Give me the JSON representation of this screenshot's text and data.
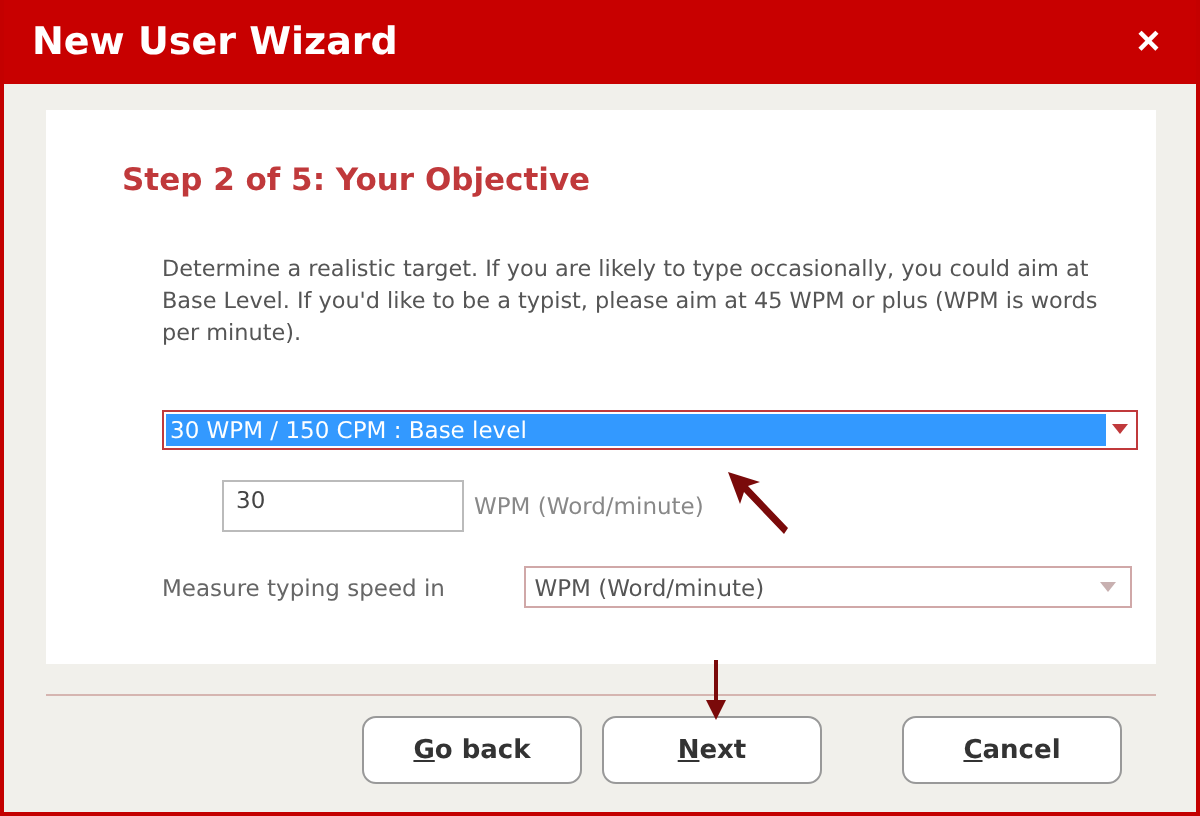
{
  "window": {
    "title": "New User Wizard",
    "close": "×"
  },
  "step_title": "Step 2 of 5: Your Objective",
  "description": "Determine a realistic target. If you are likely to type occasionally, you could aim at Base Level. If you'd like to be a typist, please aim at 45 WPM or plus (WPM is words per minute).",
  "target_select": {
    "value": "30 WPM / 150 CPM : Base level",
    "selected": true
  },
  "wpm_field": {
    "value": "30",
    "unit": "WPM (Word/minute)"
  },
  "measure": {
    "label": "Measure typing speed in",
    "value": "WPM (Word/minute)"
  },
  "buttons": [
    {
      "accel": "G",
      "rest": "o back"
    },
    {
      "accel": "N",
      "rest": "ext"
    },
    {
      "accel": "C",
      "rest": "ancel"
    }
  ]
}
